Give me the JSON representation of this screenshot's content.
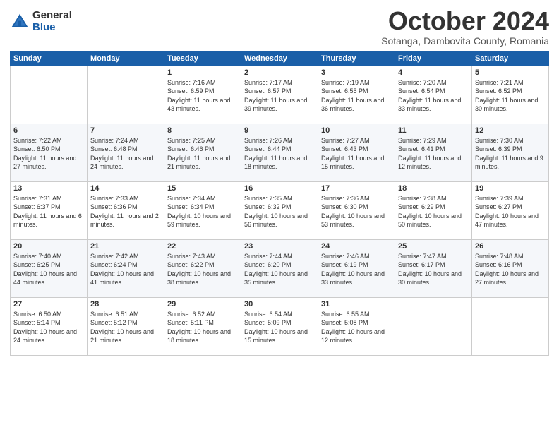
{
  "logo": {
    "general": "General",
    "blue": "Blue"
  },
  "title": "October 2024",
  "location": "Sotanga, Dambovita County, Romania",
  "days_of_week": [
    "Sunday",
    "Monday",
    "Tuesday",
    "Wednesday",
    "Thursday",
    "Friday",
    "Saturday"
  ],
  "weeks": [
    [
      {
        "day": "",
        "sunrise": "",
        "sunset": "",
        "daylight": ""
      },
      {
        "day": "",
        "sunrise": "",
        "sunset": "",
        "daylight": ""
      },
      {
        "day": "1",
        "sunrise": "Sunrise: 7:16 AM",
        "sunset": "Sunset: 6:59 PM",
        "daylight": "Daylight: 11 hours and 43 minutes."
      },
      {
        "day": "2",
        "sunrise": "Sunrise: 7:17 AM",
        "sunset": "Sunset: 6:57 PM",
        "daylight": "Daylight: 11 hours and 39 minutes."
      },
      {
        "day": "3",
        "sunrise": "Sunrise: 7:19 AM",
        "sunset": "Sunset: 6:55 PM",
        "daylight": "Daylight: 11 hours and 36 minutes."
      },
      {
        "day": "4",
        "sunrise": "Sunrise: 7:20 AM",
        "sunset": "Sunset: 6:54 PM",
        "daylight": "Daylight: 11 hours and 33 minutes."
      },
      {
        "day": "5",
        "sunrise": "Sunrise: 7:21 AM",
        "sunset": "Sunset: 6:52 PM",
        "daylight": "Daylight: 11 hours and 30 minutes."
      }
    ],
    [
      {
        "day": "6",
        "sunrise": "Sunrise: 7:22 AM",
        "sunset": "Sunset: 6:50 PM",
        "daylight": "Daylight: 11 hours and 27 minutes."
      },
      {
        "day": "7",
        "sunrise": "Sunrise: 7:24 AM",
        "sunset": "Sunset: 6:48 PM",
        "daylight": "Daylight: 11 hours and 24 minutes."
      },
      {
        "day": "8",
        "sunrise": "Sunrise: 7:25 AM",
        "sunset": "Sunset: 6:46 PM",
        "daylight": "Daylight: 11 hours and 21 minutes."
      },
      {
        "day": "9",
        "sunrise": "Sunrise: 7:26 AM",
        "sunset": "Sunset: 6:44 PM",
        "daylight": "Daylight: 11 hours and 18 minutes."
      },
      {
        "day": "10",
        "sunrise": "Sunrise: 7:27 AM",
        "sunset": "Sunset: 6:43 PM",
        "daylight": "Daylight: 11 hours and 15 minutes."
      },
      {
        "day": "11",
        "sunrise": "Sunrise: 7:29 AM",
        "sunset": "Sunset: 6:41 PM",
        "daylight": "Daylight: 11 hours and 12 minutes."
      },
      {
        "day": "12",
        "sunrise": "Sunrise: 7:30 AM",
        "sunset": "Sunset: 6:39 PM",
        "daylight": "Daylight: 11 hours and 9 minutes."
      }
    ],
    [
      {
        "day": "13",
        "sunrise": "Sunrise: 7:31 AM",
        "sunset": "Sunset: 6:37 PM",
        "daylight": "Daylight: 11 hours and 6 minutes."
      },
      {
        "day": "14",
        "sunrise": "Sunrise: 7:33 AM",
        "sunset": "Sunset: 6:36 PM",
        "daylight": "Daylight: 11 hours and 2 minutes."
      },
      {
        "day": "15",
        "sunrise": "Sunrise: 7:34 AM",
        "sunset": "Sunset: 6:34 PM",
        "daylight": "Daylight: 10 hours and 59 minutes."
      },
      {
        "day": "16",
        "sunrise": "Sunrise: 7:35 AM",
        "sunset": "Sunset: 6:32 PM",
        "daylight": "Daylight: 10 hours and 56 minutes."
      },
      {
        "day": "17",
        "sunrise": "Sunrise: 7:36 AM",
        "sunset": "Sunset: 6:30 PM",
        "daylight": "Daylight: 10 hours and 53 minutes."
      },
      {
        "day": "18",
        "sunrise": "Sunrise: 7:38 AM",
        "sunset": "Sunset: 6:29 PM",
        "daylight": "Daylight: 10 hours and 50 minutes."
      },
      {
        "day": "19",
        "sunrise": "Sunrise: 7:39 AM",
        "sunset": "Sunset: 6:27 PM",
        "daylight": "Daylight: 10 hours and 47 minutes."
      }
    ],
    [
      {
        "day": "20",
        "sunrise": "Sunrise: 7:40 AM",
        "sunset": "Sunset: 6:25 PM",
        "daylight": "Daylight: 10 hours and 44 minutes."
      },
      {
        "day": "21",
        "sunrise": "Sunrise: 7:42 AM",
        "sunset": "Sunset: 6:24 PM",
        "daylight": "Daylight: 10 hours and 41 minutes."
      },
      {
        "day": "22",
        "sunrise": "Sunrise: 7:43 AM",
        "sunset": "Sunset: 6:22 PM",
        "daylight": "Daylight: 10 hours and 38 minutes."
      },
      {
        "day": "23",
        "sunrise": "Sunrise: 7:44 AM",
        "sunset": "Sunset: 6:20 PM",
        "daylight": "Daylight: 10 hours and 35 minutes."
      },
      {
        "day": "24",
        "sunrise": "Sunrise: 7:46 AM",
        "sunset": "Sunset: 6:19 PM",
        "daylight": "Daylight: 10 hours and 33 minutes."
      },
      {
        "day": "25",
        "sunrise": "Sunrise: 7:47 AM",
        "sunset": "Sunset: 6:17 PM",
        "daylight": "Daylight: 10 hours and 30 minutes."
      },
      {
        "day": "26",
        "sunrise": "Sunrise: 7:48 AM",
        "sunset": "Sunset: 6:16 PM",
        "daylight": "Daylight: 10 hours and 27 minutes."
      }
    ],
    [
      {
        "day": "27",
        "sunrise": "Sunrise: 6:50 AM",
        "sunset": "Sunset: 5:14 PM",
        "daylight": "Daylight: 10 hours and 24 minutes."
      },
      {
        "day": "28",
        "sunrise": "Sunrise: 6:51 AM",
        "sunset": "Sunset: 5:12 PM",
        "daylight": "Daylight: 10 hours and 21 minutes."
      },
      {
        "day": "29",
        "sunrise": "Sunrise: 6:52 AM",
        "sunset": "Sunset: 5:11 PM",
        "daylight": "Daylight: 10 hours and 18 minutes."
      },
      {
        "day": "30",
        "sunrise": "Sunrise: 6:54 AM",
        "sunset": "Sunset: 5:09 PM",
        "daylight": "Daylight: 10 hours and 15 minutes."
      },
      {
        "day": "31",
        "sunrise": "Sunrise: 6:55 AM",
        "sunset": "Sunset: 5:08 PM",
        "daylight": "Daylight: 10 hours and 12 minutes."
      },
      {
        "day": "",
        "sunrise": "",
        "sunset": "",
        "daylight": ""
      },
      {
        "day": "",
        "sunrise": "",
        "sunset": "",
        "daylight": ""
      }
    ]
  ]
}
